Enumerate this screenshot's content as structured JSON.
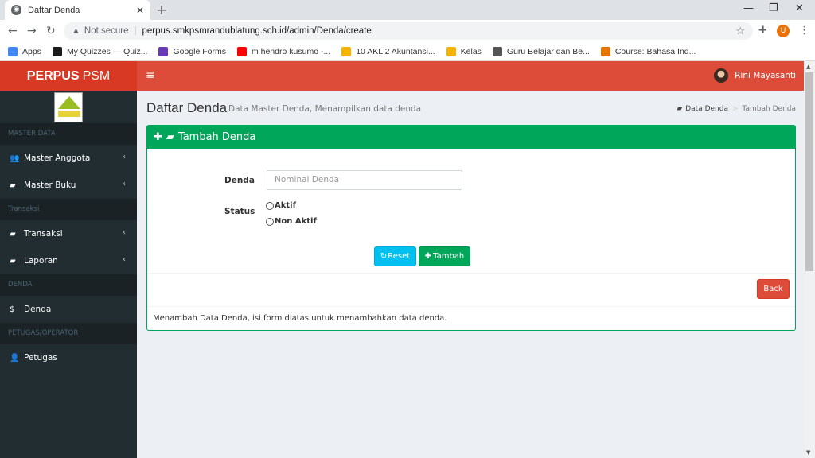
{
  "browser": {
    "tab_title": "Daftar Denda",
    "security_label": "Not secure",
    "url": "perpus.smkpsmrandublatung.sch.id/admin/Denda/create",
    "profile_initial": "U",
    "bookmarks": [
      {
        "label": "Apps",
        "color": "#4285f4"
      },
      {
        "label": "My Quizzes — Quiz...",
        "color": "#1a1a1a"
      },
      {
        "label": "Google Forms",
        "color": "#673ab7"
      },
      {
        "label": "m hendro kusumo -...",
        "color": "#ff0000"
      },
      {
        "label": "10 AKL 2 Akuntansi...",
        "color": "#f4b400"
      },
      {
        "label": "Kelas",
        "color": "#f4b400"
      },
      {
        "label": "Guru Belajar dan Be...",
        "color": "#555555"
      },
      {
        "label": "Course: Bahasa Ind...",
        "color": "#e37400"
      }
    ]
  },
  "app": {
    "logo_bold": "PERPUS",
    "logo_light": "PSM",
    "user_name": "Rini Mayasanti"
  },
  "sidebar": {
    "sections": [
      {
        "header": "MASTER DATA",
        "items": [
          {
            "label": "Master Anggota",
            "icon": "users-icon",
            "arrow": true
          },
          {
            "label": "Master Buku",
            "icon": "book-icon",
            "arrow": true
          }
        ]
      },
      {
        "header": "Transaksi",
        "items": [
          {
            "label": "Transaksi",
            "icon": "book-icon",
            "arrow": true
          },
          {
            "label": "Laporan",
            "icon": "book-icon",
            "arrow": true
          }
        ]
      },
      {
        "header": "DENDA",
        "items": [
          {
            "label": "Denda",
            "icon": "dollar-icon",
            "arrow": false
          }
        ]
      },
      {
        "header": "PETUGAS/OPERATOR",
        "items": [
          {
            "label": "Petugas",
            "icon": "user-plus-icon",
            "arrow": false
          }
        ]
      }
    ]
  },
  "page": {
    "title": "Daftar Denda",
    "subtitle": "Data Master Denda, Menampilkan data denda",
    "breadcrumb": [
      "Data Denda",
      "Tambah Denda"
    ]
  },
  "form": {
    "header": "Tambah Denda",
    "denda_label": "Denda",
    "denda_placeholder": "Nominal Denda",
    "status_label": "Status",
    "status_options": [
      "Aktif",
      "Non Aktif"
    ],
    "reset_label": "Reset",
    "tambah_label": "Tambah",
    "back_label": "Back",
    "footer_note": "Menambah Data Denda, isi form diatas untuk menambahkan data denda."
  },
  "colors": {
    "primary_red": "#dd4b39",
    "sidebar_dark": "#222d32",
    "success_green": "#00a65a",
    "info_cyan": "#00c0ef"
  }
}
